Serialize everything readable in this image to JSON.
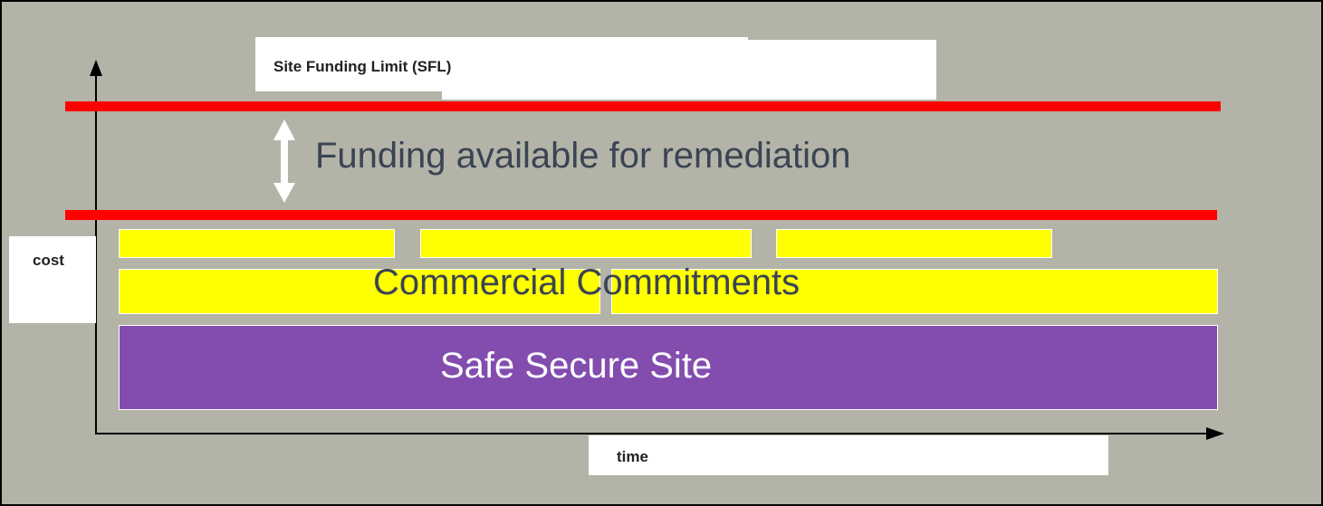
{
  "labels": {
    "sfl": "Site Funding Limit (SFL)",
    "funding": "Funding available for remediation",
    "commercial": "Commercial Commitments",
    "safe": "Safe Secure Site",
    "cost_axis": "cost",
    "time_axis": "time"
  },
  "colors": {
    "background": "#b3b3a8",
    "limit_line": "#ff0000",
    "commitments": "#ffff00",
    "safe_secure": "#824daf",
    "arrow": "#ffffff",
    "axis": "#000000"
  }
}
